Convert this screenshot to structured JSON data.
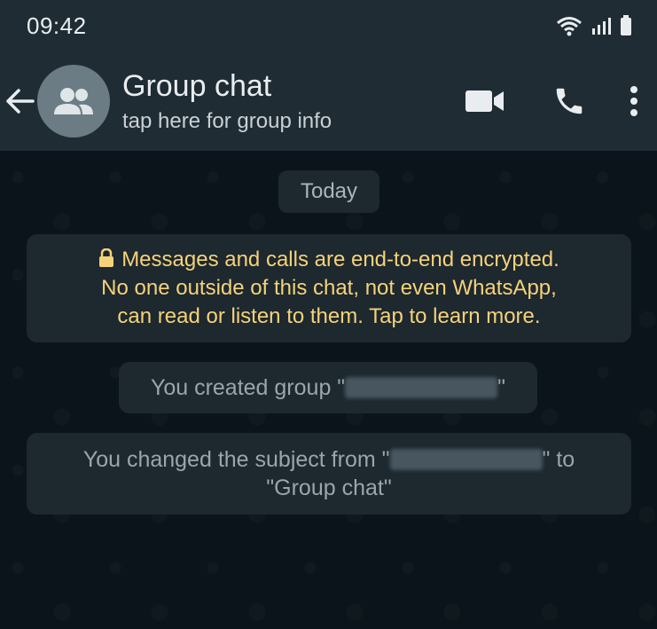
{
  "status_bar": {
    "time": "09:42",
    "icons": [
      "wifi-icon",
      "signal-icon",
      "battery-icon"
    ]
  },
  "header": {
    "back_icon": "arrow-left-icon",
    "avatar_icon": "group-icon",
    "title": "Group chat",
    "subtitle": "tap here for group info",
    "actions": [
      "video-call-icon",
      "voice-call-icon",
      "more-options-icon"
    ]
  },
  "chat": {
    "date_label": "Today",
    "encryption_lines": [
      "Messages and calls are end-to-end encrypted.",
      "No one outside of this chat, not even WhatsApp,",
      "can read or listen to them. Tap to learn more."
    ],
    "created_prefix": "You created group \"",
    "created_suffix": "\"",
    "changed_prefix": "You changed the subject from \"",
    "changed_mid": "\" to",
    "changed_new": "\"Group chat\""
  },
  "colors": {
    "app_bar": "#1f2c34",
    "background": "#0b141a",
    "bubble": "#1d282f",
    "encryption_text": "#f5d27a",
    "system_text": "#9aa6ad"
  }
}
